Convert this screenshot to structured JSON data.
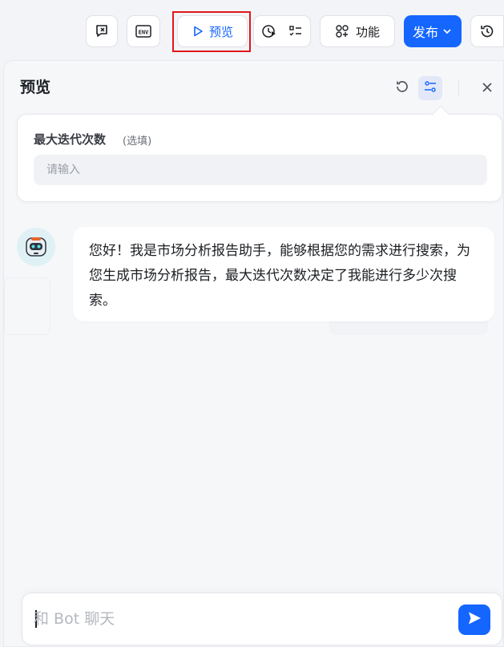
{
  "toolbar": {
    "preview_label": "预览",
    "features_label": "功能",
    "publish_label": "发布"
  },
  "panel": {
    "title": "预览",
    "param": {
      "label": "最大迭代次数",
      "optional": "(选填)",
      "placeholder": "请输入"
    }
  },
  "chat": {
    "bot_message": "您好！我是市场分析报告助手，能够根据您的需求进行搜索，为您生成市场分析报告，最大迭代次数决定了我能进行多少次搜索。",
    "input_placeholder": "和 Bot 聊天"
  },
  "colors": {
    "accent": "#1466ff",
    "highlight_border": "#e0171b",
    "panel_bg": "#f6f7f9"
  }
}
